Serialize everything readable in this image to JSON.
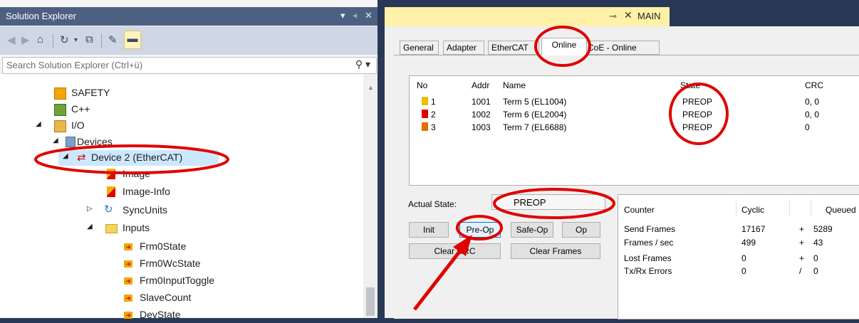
{
  "solution_explorer": {
    "title": "Solution Explorer",
    "title_controls": [
      "▾",
      "⫞",
      "✕"
    ],
    "search_placeholder": "Search Solution Explorer (Ctrl+ü)",
    "tree": [
      {
        "label": "SAFETY",
        "icon": "safety-icon"
      },
      {
        "label": "C++",
        "icon": "cpp-icon"
      },
      {
        "label": "I/O",
        "icon": "io-icon"
      },
      {
        "label": "Devices",
        "icon": "devices-icon"
      },
      {
        "label": "Device 2 (EtherCAT)",
        "icon": "ethercat-device-icon"
      },
      {
        "label": "Image",
        "icon": "image-icon"
      },
      {
        "label": "Image-Info",
        "icon": "image-info-icon"
      },
      {
        "label": "SyncUnits",
        "icon": "syncunits-icon"
      },
      {
        "label": "Inputs",
        "icon": "folder-icon"
      },
      {
        "label": "Frm0State",
        "icon": "input-var-icon"
      },
      {
        "label": "Frm0WcState",
        "icon": "input-var-icon"
      },
      {
        "label": "Frm0InputToggle",
        "icon": "input-var-icon"
      },
      {
        "label": "SlaveCount",
        "icon": "input-var-icon"
      },
      {
        "label": "DevState",
        "icon": "input-var-icon"
      }
    ]
  },
  "main": {
    "tab_name": "MAIN",
    "tab_pin": "⊸",
    "tab_close": "✕",
    "tabs": [
      "General",
      "Adapter",
      "EtherCAT",
      "Online",
      "CoE - Online"
    ],
    "active_tab": "Online",
    "device_list": {
      "headers": [
        "No",
        "Addr",
        "Name",
        "State",
        "CRC"
      ],
      "rows": [
        {
          "no": "1",
          "addr": "1001",
          "name": "Term 5 (EL1004)",
          "state": "PREOP",
          "crc": "0, 0",
          "color": "#e8c000"
        },
        {
          "no": "2",
          "addr": "1002",
          "name": "Term 6 (EL2004)",
          "state": "PREOP",
          "crc": "0, 0",
          "color": "#e00000"
        },
        {
          "no": "3",
          "addr": "1003",
          "name": "Term 7 (EL6688)",
          "state": "PREOP",
          "crc": "0",
          "color": "#e07000"
        }
      ]
    },
    "actual_state_label": "Actual State:",
    "actual_state_value": "PREOP",
    "buttons": {
      "init": "Init",
      "preop": "Pre-Op",
      "safeop": "Safe-Op",
      "op": "Op",
      "clear_crc": "Clear CRC",
      "clear_frames": "Clear Frames"
    },
    "counter": {
      "headers": [
        "Counter",
        "Cyclic",
        "Queued"
      ],
      "rows": [
        {
          "label": "Send Frames",
          "cyclic": "17167",
          "op": "+",
          "queued": "5289"
        },
        {
          "label": "Frames / sec",
          "cyclic": "499",
          "op": "+",
          "queued": "43"
        },
        {
          "label": "Lost Frames",
          "cyclic": "0",
          "op": "+",
          "queued": "0"
        },
        {
          "label": "Tx/Rx Errors",
          "cyclic": "0",
          "op": "/",
          "queued": "0"
        }
      ]
    }
  },
  "colors": {
    "annotation": "#e00000",
    "title_bar": "#4d6082",
    "selection": "#cce8ff",
    "main_tab": "#fff1a8"
  }
}
